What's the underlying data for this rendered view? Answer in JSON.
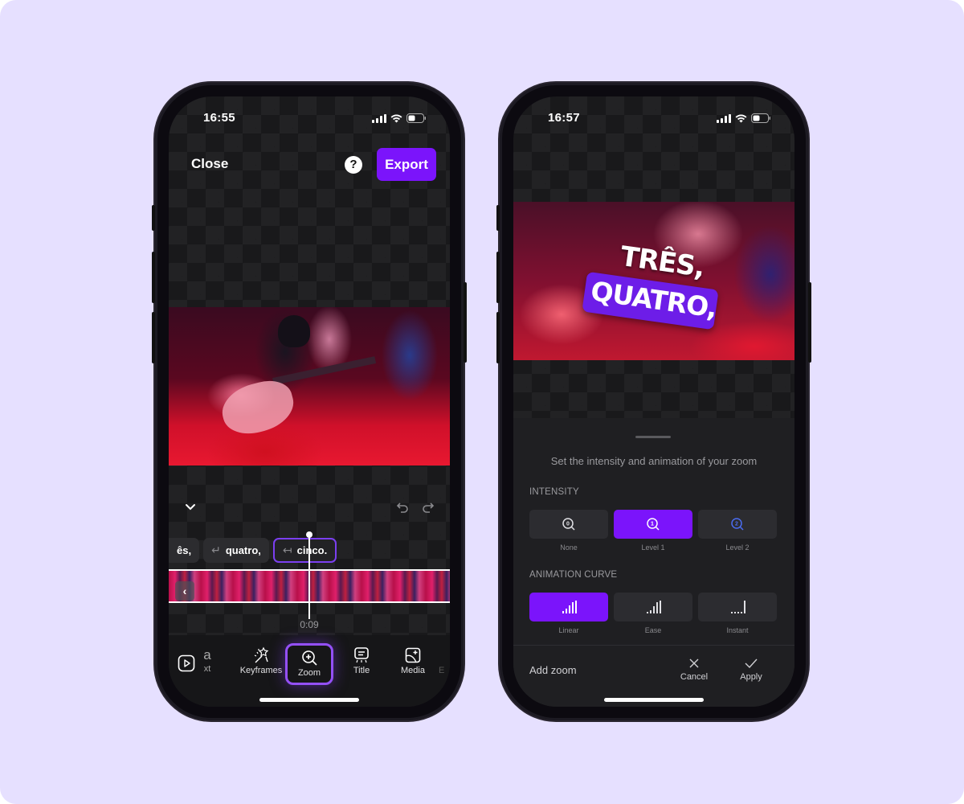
{
  "left_phone": {
    "status": {
      "time": "16:55"
    },
    "header": {
      "close_label": "Close",
      "help_label": "?",
      "export_label": "Export"
    },
    "timeline": {
      "captions": [
        {
          "text": "ês,",
          "glyph": ""
        },
        {
          "text": "quatro,",
          "glyph": "↵"
        },
        {
          "text": "cinco.",
          "glyph": "↤"
        }
      ],
      "active_caption_index": 2,
      "back_label": "‹",
      "time": "0:09"
    },
    "tools": [
      {
        "label": "",
        "icon": "play-icon"
      },
      {
        "label": "xt",
        "top_text": "a",
        "icon": "text-icon"
      },
      {
        "label": "Keyframes",
        "icon": "keyframes-icon"
      },
      {
        "label": "Zoom",
        "icon": "zoom-icon"
      },
      {
        "label": "Title",
        "icon": "title-icon"
      },
      {
        "label": "Media",
        "icon": "media-icon"
      },
      {
        "label": "E",
        "icon": "effects-icon"
      }
    ],
    "active_tool": "Zoom"
  },
  "right_phone": {
    "status": {
      "time": "16:57"
    },
    "preview_captions": {
      "line1": "TRÊS,",
      "line2": "QUATRO,"
    },
    "sheet": {
      "title": "Set the intensity and animation of your zoom",
      "intensity": {
        "label": "INTENSITY",
        "options": [
          {
            "label": "None",
            "digit": "0"
          },
          {
            "label": "Level 1",
            "digit": "1"
          },
          {
            "label": "Level 2",
            "digit": "2"
          }
        ],
        "selected": "Level 1"
      },
      "curve": {
        "label": "ANIMATION CURVE",
        "options": [
          {
            "label": "Linear"
          },
          {
            "label": "Ease"
          },
          {
            "label": "Instant"
          }
        ],
        "selected": "Linear"
      },
      "footer": {
        "title": "Add zoom",
        "cancel_label": "Cancel",
        "apply_label": "Apply"
      }
    }
  },
  "colors": {
    "accent": "#7b14fb",
    "background": "#e6e0ff",
    "level2_icon": "#4a6cf0"
  }
}
